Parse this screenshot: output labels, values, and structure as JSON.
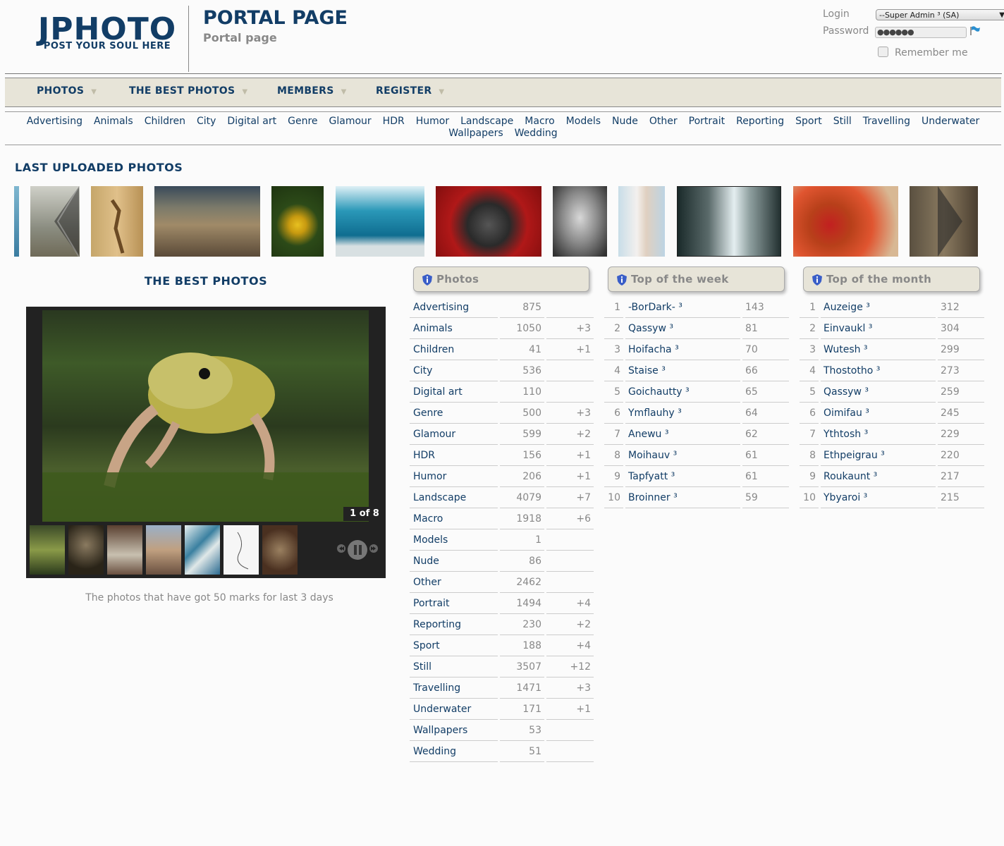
{
  "header": {
    "logo_title": "JPHOTO",
    "logo_sub": "POST YOUR SOUL HERE",
    "page_title": "PORTAL PAGE",
    "page_sub": "Portal page",
    "login_label": "Login",
    "login_value": "--Super Admin ³ (SA)",
    "password_label": "Password",
    "password_value": "●●●●●●",
    "remember_label": "Remember me"
  },
  "nav": [
    "PHOTOS",
    "THE BEST PHOTOS",
    "MEMBERS",
    "REGISTER"
  ],
  "categories_line1": [
    "Advertising",
    "Animals",
    "Children",
    "City",
    "Digital art",
    "Genre",
    "Glamour",
    "HDR",
    "Humor",
    "Landscape",
    "Macro",
    "Models",
    "Nude",
    "Other",
    "Portrait",
    "Reporting",
    "Sport",
    "Still",
    "Travelling",
    "Underwater"
  ],
  "categories_line2": [
    "Wallpapers",
    "Wedding"
  ],
  "last_uploaded": {
    "title": "LAST UPLOADED PHOTOS"
  },
  "best": {
    "title": "THE BEST PHOTOS",
    "counter": "1 of 8",
    "caption": "The photos that have got 50 marks for last 3 days"
  },
  "photos_panel": {
    "title": "Photos",
    "rows": [
      {
        "name": "Advertising",
        "count": "875",
        "delta": ""
      },
      {
        "name": "Animals",
        "count": "1050",
        "delta": "+3"
      },
      {
        "name": "Children",
        "count": "41",
        "delta": "+1"
      },
      {
        "name": "City",
        "count": "536",
        "delta": ""
      },
      {
        "name": "Digital art",
        "count": "110",
        "delta": ""
      },
      {
        "name": "Genre",
        "count": "500",
        "delta": "+3"
      },
      {
        "name": "Glamour",
        "count": "599",
        "delta": "+2"
      },
      {
        "name": "HDR",
        "count": "156",
        "delta": "+1"
      },
      {
        "name": "Humor",
        "count": "206",
        "delta": "+1"
      },
      {
        "name": "Landscape",
        "count": "4079",
        "delta": "+7"
      },
      {
        "name": "Macro",
        "count": "1918",
        "delta": "+6"
      },
      {
        "name": "Models",
        "count": "1",
        "delta": ""
      },
      {
        "name": "Nude",
        "count": "86",
        "delta": ""
      },
      {
        "name": "Other",
        "count": "2462",
        "delta": ""
      },
      {
        "name": "Portrait",
        "count": "1494",
        "delta": "+4"
      },
      {
        "name": "Reporting",
        "count": "230",
        "delta": "+2"
      },
      {
        "name": "Sport",
        "count": "188",
        "delta": "+4"
      },
      {
        "name": "Still",
        "count": "3507",
        "delta": "+12"
      },
      {
        "name": "Travelling",
        "count": "1471",
        "delta": "+3"
      },
      {
        "name": "Underwater",
        "count": "171",
        "delta": "+1"
      },
      {
        "name": "Wallpapers",
        "count": "53",
        "delta": ""
      },
      {
        "name": "Wedding",
        "count": "51",
        "delta": ""
      }
    ]
  },
  "week_panel": {
    "title": "Top of the week",
    "rows": [
      {
        "rank": "1",
        "name": "-BorDark- ³",
        "score": "143"
      },
      {
        "rank": "2",
        "name": "Qassyw ³",
        "score": "81"
      },
      {
        "rank": "3",
        "name": "Hoifacha ³",
        "score": "70"
      },
      {
        "rank": "4",
        "name": "Staise ³",
        "score": "66"
      },
      {
        "rank": "5",
        "name": "Goichautty ³",
        "score": "65"
      },
      {
        "rank": "6",
        "name": "Ymflauhy ³",
        "score": "64"
      },
      {
        "rank": "7",
        "name": "Anewu ³",
        "score": "62"
      },
      {
        "rank": "8",
        "name": "Moihauv ³",
        "score": "61"
      },
      {
        "rank": "9",
        "name": "Tapfyatt ³",
        "score": "61"
      },
      {
        "rank": "10",
        "name": "Broinner ³",
        "score": "59"
      }
    ]
  },
  "month_panel": {
    "title": "Top of the month",
    "rows": [
      {
        "rank": "1",
        "name": "Auzeige ³",
        "score": "312"
      },
      {
        "rank": "2",
        "name": "Einvaukl ³",
        "score": "304"
      },
      {
        "rank": "3",
        "name": "Wutesh ³",
        "score": "299"
      },
      {
        "rank": "4",
        "name": "Thostotho ³",
        "score": "273"
      },
      {
        "rank": "5",
        "name": "Qassyw ³",
        "score": "259"
      },
      {
        "rank": "6",
        "name": "Oimifau ³",
        "score": "245"
      },
      {
        "rank": "7",
        "name": "Ythtosh ³",
        "score": "229"
      },
      {
        "rank": "8",
        "name": "Ethpeigrau ³",
        "score": "220"
      },
      {
        "rank": "9",
        "name": "Roukaunt ³",
        "score": "217"
      },
      {
        "rank": "10",
        "name": "Ybyaroi ³",
        "score": "215"
      }
    ]
  },
  "icons": {
    "panel_icon": "shield-info-icon",
    "login_submit": "flag-icon",
    "strip_prev": "chevron-left-icon",
    "strip_next": "chevron-right-icon",
    "slideshow_controls": [
      "rewind-icon",
      "pause-icon",
      "fast-forward-icon"
    ]
  },
  "colors": {
    "brand": "#123d66",
    "nav_bg": "#e7e4d8",
    "muted": "#888888"
  }
}
